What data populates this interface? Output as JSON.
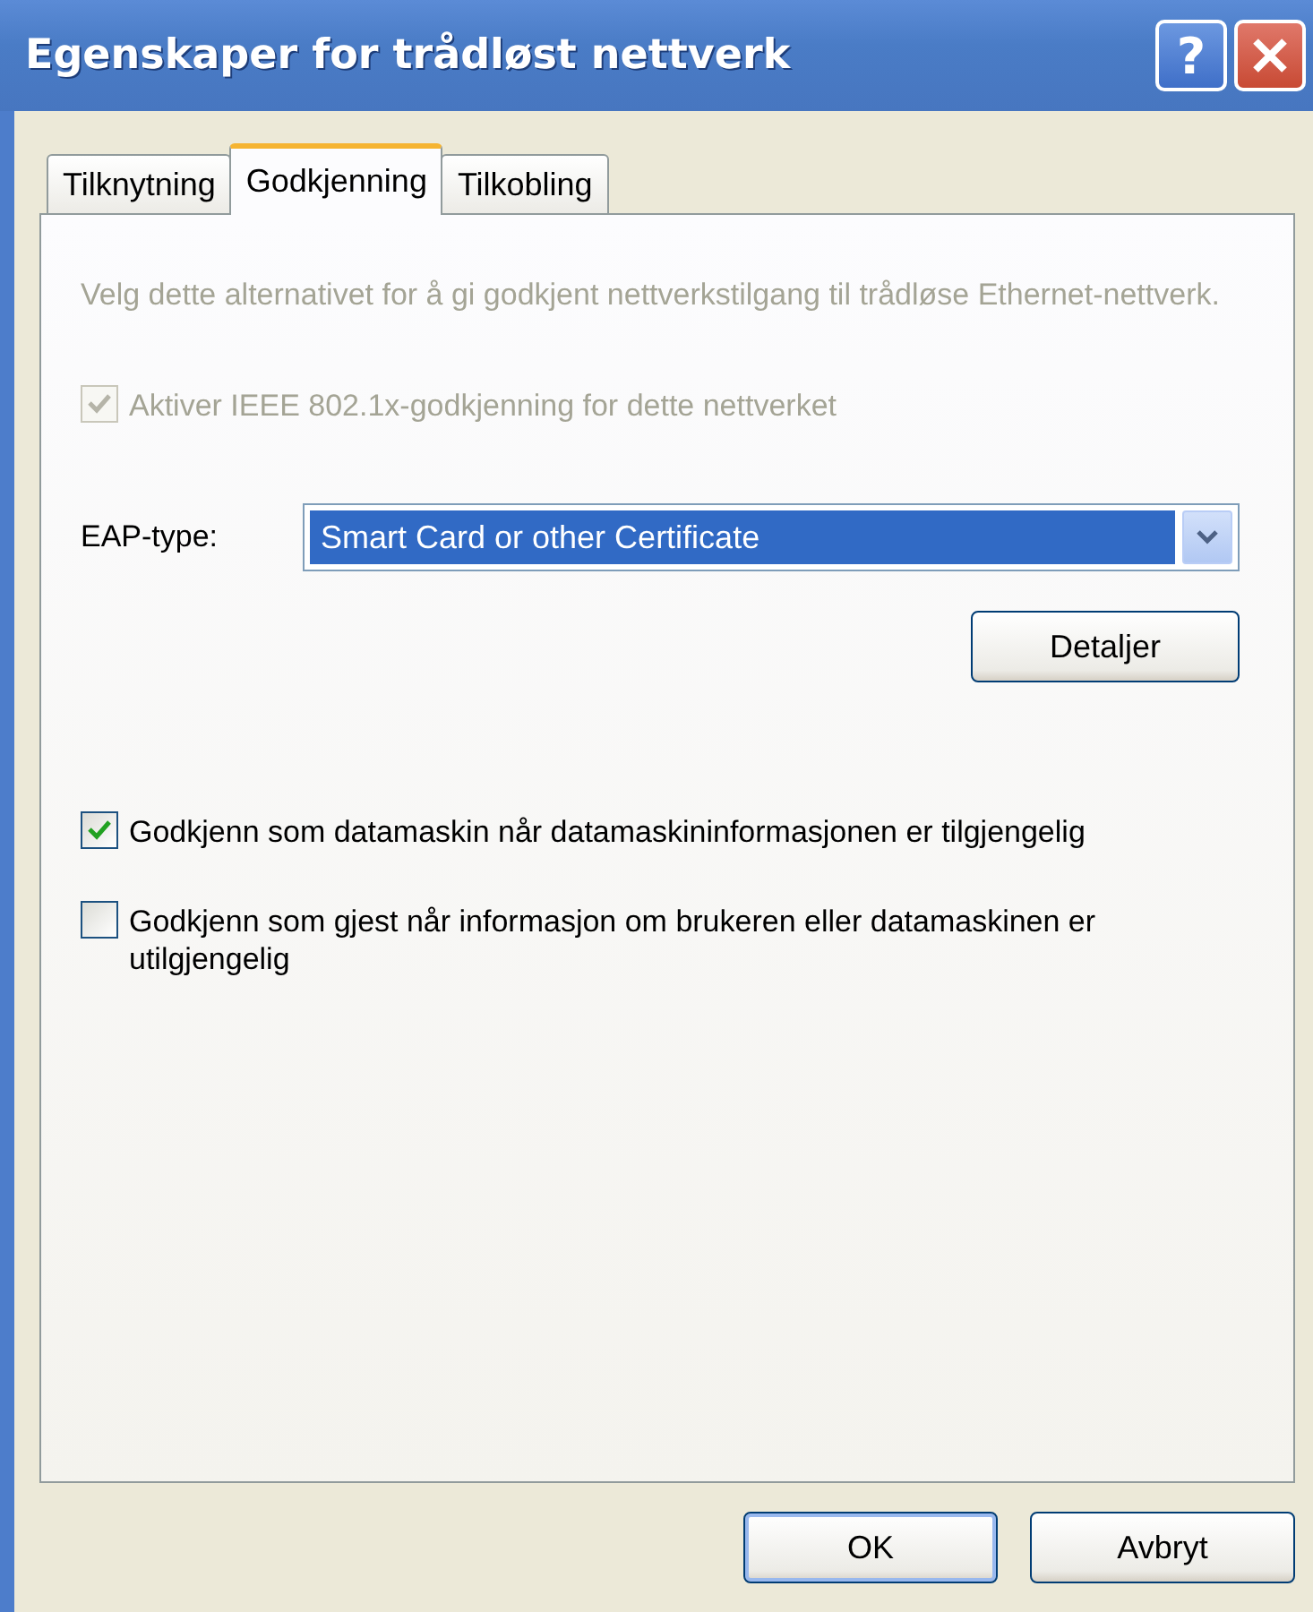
{
  "window": {
    "title": "Egenskaper for trådløst nettverk",
    "help_button": "?"
  },
  "tabs": [
    {
      "label": "Tilknytning",
      "selected": false
    },
    {
      "label": "Godkjenning",
      "selected": true
    },
    {
      "label": "Tilkobling",
      "selected": false
    }
  ],
  "description": {
    "text": "Velg dette alternativet for å gi godkjent nettverkstilgang til trådløse Ethernet-nettverk.",
    "disabled": true
  },
  "ieee_checkbox": {
    "label": "Aktiver IEEE 802.1x-godkjenning for dette nettverket",
    "checked": true,
    "disabled": true
  },
  "eap_type": {
    "label": "EAP-type:",
    "value": "Smart Card or other Certificate"
  },
  "details_button": "Detaljer",
  "options": [
    {
      "label": "Godkjenn som datamaskin når datamaskininformasjonen er tilgjengelig",
      "checked": true
    },
    {
      "label": "Godkjenn som gjest når informasjon om brukeren eller datamaskinen er utilgjengelig",
      "checked": false
    }
  ],
  "buttons": [
    {
      "label": "OK",
      "default": true
    },
    {
      "label": "Avbryt",
      "default": false
    }
  ]
}
